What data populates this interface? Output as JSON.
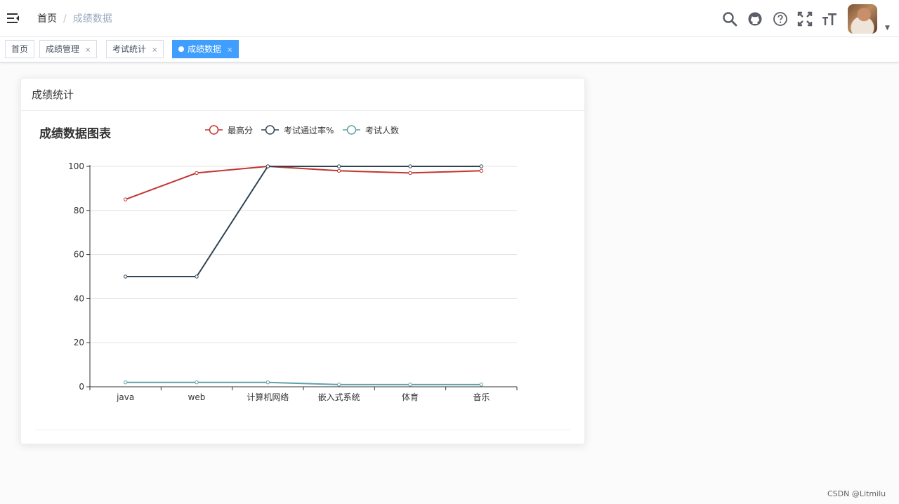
{
  "navbar": {
    "breadcrumb": {
      "home": "首页",
      "separator": "/",
      "current": "成绩数据"
    },
    "icons": [
      "hamburger-icon",
      "search-icon",
      "github-icon",
      "help-icon",
      "fullscreen-icon",
      "text-size-icon"
    ]
  },
  "tags": [
    {
      "label": "首页",
      "closable": false,
      "active": false
    },
    {
      "label": "成绩管理",
      "closable": true,
      "active": false
    },
    {
      "label": "考试统计",
      "closable": true,
      "active": false
    },
    {
      "label": "成绩数据",
      "closable": true,
      "active": true
    }
  ],
  "tag_close_symbol": "×",
  "card": {
    "header": "成绩统计"
  },
  "chart_data": {
    "type": "line",
    "title": "成绩数据图表",
    "categories": [
      "java",
      "web",
      "计算机网络",
      "嵌入式系统",
      "体育",
      "音乐"
    ],
    "series": [
      {
        "name": "最高分",
        "color": "#c23531",
        "values": [
          85,
          97,
          100,
          98,
          97,
          98
        ]
      },
      {
        "name": "考试通过率%",
        "color": "#2f4554",
        "values": [
          50,
          50,
          100,
          100,
          100,
          100
        ]
      },
      {
        "name": "考试人数",
        "color": "#61a0a8",
        "values": [
          2,
          2,
          2,
          1,
          1,
          1
        ]
      }
    ],
    "ylim": [
      0,
      100
    ],
    "yticks": [
      0,
      20,
      40,
      60,
      80,
      100
    ],
    "grid": true,
    "legend_position": "top"
  },
  "watermark": "CSDN @Litmilu"
}
